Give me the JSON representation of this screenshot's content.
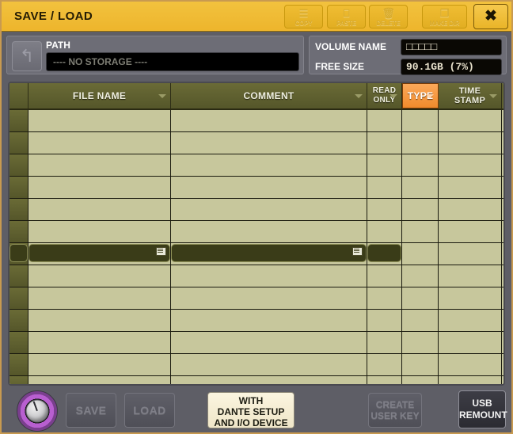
{
  "window": {
    "title": "SAVE / LOAD",
    "close_label": "✖",
    "accent_color": "#edb52c",
    "panel_color": "#5e5e66",
    "table_color": "#c7c79c",
    "header_color": "#5f6030",
    "active_sort_color": "#f08a2c"
  },
  "toolbar": {
    "buttons": [
      {
        "label": "COPY",
        "icon": "copy-icon",
        "glyph": "☰",
        "enabled": false
      },
      {
        "label": "PASTE",
        "icon": "paste-icon",
        "glyph": "⎕",
        "enabled": false
      },
      {
        "label": "DELETE",
        "icon": "delete-icon",
        "glyph": "🗑",
        "enabled": false
      },
      {
        "label": "MAKE DIR",
        "icon": "folder-plus-icon",
        "glyph": "❐",
        "enabled": false
      }
    ]
  },
  "info": {
    "up_icon": "arrow-up-folder-icon",
    "up_glyph": "↰",
    "path_label": "PATH",
    "path_value": "---- NO STORAGE ----",
    "volume_label": "VOLUME NAME",
    "volume_value": "□□□□□",
    "free_size_label": "FREE SIZE",
    "free_size_value": "90.1GB (7%)"
  },
  "table": {
    "columns": [
      {
        "key": "icon",
        "label": "",
        "sortable": false,
        "active": false
      },
      {
        "key": "file_name",
        "label": "FILE NAME",
        "sortable": true,
        "active": false
      },
      {
        "key": "comment",
        "label": "COMMENT",
        "sortable": true,
        "active": false
      },
      {
        "key": "read_only",
        "label_line1": "READ",
        "label_line2": "ONLY",
        "sortable": true,
        "active": false
      },
      {
        "key": "type",
        "label": "TYPE",
        "sortable": true,
        "active": true
      },
      {
        "key": "time_stamp",
        "label_line1": "TIME",
        "label_line2": "STAMP",
        "sortable": true,
        "active": false
      }
    ],
    "rows": [
      {
        "selected": false,
        "file_name": "",
        "comment": "",
        "read_only": "",
        "type": "",
        "time_stamp": ""
      },
      {
        "selected": false,
        "file_name": "",
        "comment": "",
        "read_only": "",
        "type": "",
        "time_stamp": ""
      },
      {
        "selected": false,
        "file_name": "",
        "comment": "",
        "read_only": "",
        "type": "",
        "time_stamp": ""
      },
      {
        "selected": false,
        "file_name": "",
        "comment": "",
        "read_only": "",
        "type": "",
        "time_stamp": ""
      },
      {
        "selected": false,
        "file_name": "",
        "comment": "",
        "read_only": "",
        "type": "",
        "time_stamp": ""
      },
      {
        "selected": false,
        "file_name": "",
        "comment": "",
        "read_only": "",
        "type": "",
        "time_stamp": ""
      },
      {
        "selected": true,
        "file_name": "",
        "comment": "",
        "read_only": "",
        "type": "",
        "time_stamp": ""
      },
      {
        "selected": false,
        "file_name": "",
        "comment": "",
        "read_only": "",
        "type": "",
        "time_stamp": ""
      },
      {
        "selected": false,
        "file_name": "",
        "comment": "",
        "read_only": "",
        "type": "",
        "time_stamp": ""
      },
      {
        "selected": false,
        "file_name": "",
        "comment": "",
        "read_only": "",
        "type": "",
        "time_stamp": ""
      },
      {
        "selected": false,
        "file_name": "",
        "comment": "",
        "read_only": "",
        "type": "",
        "time_stamp": ""
      },
      {
        "selected": false,
        "file_name": "",
        "comment": "",
        "read_only": "",
        "type": "",
        "time_stamp": ""
      },
      {
        "selected": false,
        "file_name": "",
        "comment": "",
        "read_only": "",
        "type": "",
        "time_stamp": ""
      }
    ]
  },
  "footer": {
    "knob_name": "scroll-encoder-knob",
    "save_label": "SAVE",
    "save_enabled": false,
    "load_label": "LOAD",
    "load_enabled": false,
    "dante_line1": "WITH",
    "dante_line2": "DANTE SETUP",
    "dante_line3": "AND I/O DEVICE",
    "dante_enabled": true,
    "user_key_line1": "CREATE",
    "user_key_line2": "USER KEY",
    "user_key_enabled": false,
    "usb_line1": "USB",
    "usb_line2": "REMOUNT",
    "usb_enabled": true
  }
}
